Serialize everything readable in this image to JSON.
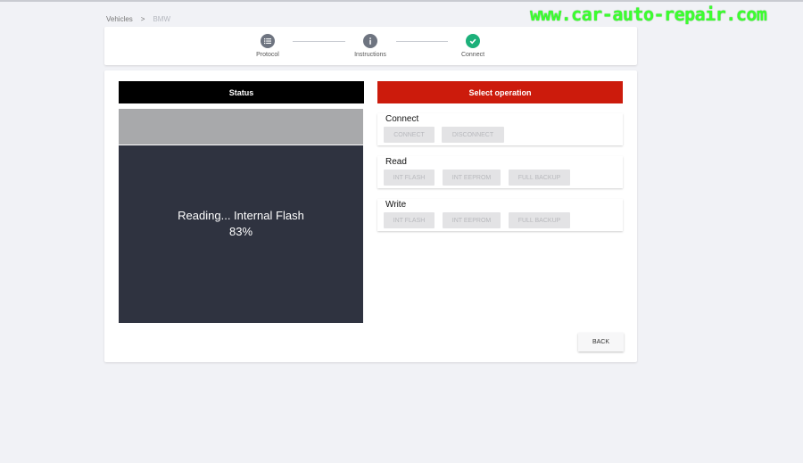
{
  "breadcrumb": {
    "items": [
      "Vehicles",
      "BMW"
    ],
    "separator": ">"
  },
  "watermark": "www.car-auto-repair.com",
  "stepper": {
    "steps": [
      {
        "label": "Protocol",
        "icon": "list-icon",
        "state": "inactive"
      },
      {
        "label": "Instructions",
        "icon": "info-icon",
        "state": "inactive"
      },
      {
        "label": "Connect",
        "icon": "checkmark-icon",
        "state": "done"
      }
    ]
  },
  "status": {
    "header": "Status",
    "message": "Reading... Internal Flash",
    "progress_text": "83%"
  },
  "operations": {
    "header": "Select operation",
    "groups": [
      {
        "title": "Connect",
        "buttons": [
          "CONNECT",
          "DISCONNECT"
        ]
      },
      {
        "title": "Read",
        "buttons": [
          "INT FLASH",
          "INT EEPROM",
          "FULL BACKUP"
        ]
      },
      {
        "title": "Write",
        "buttons": [
          "INT FLASH",
          "INT EEPROM",
          "FULL BACKUP"
        ]
      }
    ]
  },
  "back_label": "BACK",
  "colors": {
    "status_header": "#000000",
    "operation_header": "#cc1b0c",
    "status_panel": "#2f3340",
    "step_done": "#1cb07a",
    "step_inactive": "#6e7480",
    "watermark": "#3bff2e"
  }
}
